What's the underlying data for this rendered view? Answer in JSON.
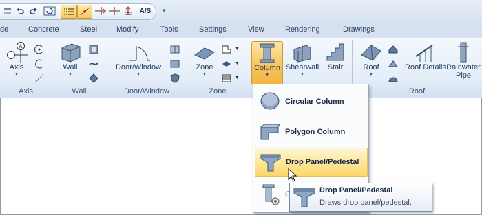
{
  "toolbar": {
    "dropdown_glyph": "▾",
    "buttons": [
      {
        "name": "layers-icon"
      },
      {
        "name": "undo-icon"
      },
      {
        "name": "redo-icon"
      },
      {
        "name": "refresh-icon"
      },
      {
        "name": "snap-grid-icon"
      },
      {
        "name": "snap-point-icon"
      },
      {
        "name": "trim-icon"
      },
      {
        "name": "extend-icon"
      },
      {
        "name": "text-style-icon"
      }
    ],
    "text_style_label": "A/S"
  },
  "tabs": [
    "de",
    "Concrete",
    "Steel",
    "Modify",
    "Tools",
    "Settings",
    "View",
    "Rendering",
    "Drawings"
  ],
  "groups": {
    "axis": {
      "label": "Axis",
      "button": "Axis"
    },
    "wall": {
      "label": "Wall",
      "button": "Wall"
    },
    "door_window": {
      "label": "Door/Window",
      "button": "Door/Window"
    },
    "zone": {
      "label": "Zone",
      "button": "Zone"
    },
    "stair_group": {
      "buttons": [
        "Column",
        "Shearwall",
        "Stair"
      ]
    },
    "roof": {
      "label": "Roof",
      "buttons": [
        "Roof",
        "Roof Details",
        "Rainwater Pipe"
      ]
    },
    "axis_letter": "A"
  },
  "menu": {
    "items": [
      {
        "label": "Circular Column",
        "icon": "circular-column-icon"
      },
      {
        "label": "Polygon Column",
        "icon": "polygon-column-icon"
      },
      {
        "label": "Drop Panel/Pedestal",
        "icon": "drop-panel-icon",
        "highlighted": true
      },
      {
        "label": "Co",
        "icon": "column-settings-icon"
      }
    ]
  },
  "tooltip": {
    "title": "Drop Panel/Pedestal",
    "description": "Draws drop panel/pedestal."
  },
  "colors": {
    "ribbon_bg": "#e4edf8",
    "highlight": "#fcd86a",
    "text": "#1e395b"
  }
}
